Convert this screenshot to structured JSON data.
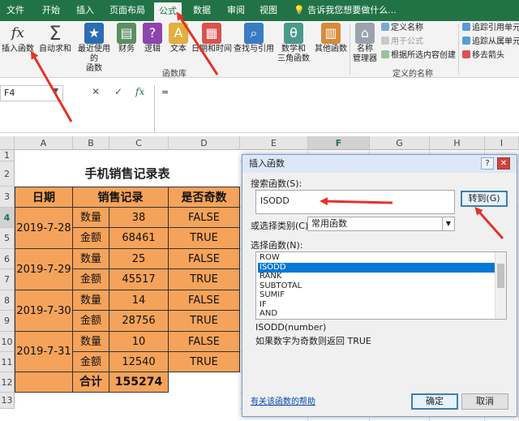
{
  "ribbon_tabs": [
    "文件",
    "开始",
    "插入",
    "页面布局",
    "公式",
    "数据",
    "审阅",
    "视图"
  ],
  "active_tab": "公式",
  "tell_me": "告诉我您想要做什么...",
  "ribbon_buttons": {
    "insert_function": "插入函数",
    "autosum": "自动求和",
    "recent_line1": "最近使用的",
    "recent_line2": "函数",
    "financial": "财务",
    "logical": "逻辑",
    "text": "文本",
    "datetime": "日期和时间",
    "lookup": "查找与引用",
    "math_line1": "数学和",
    "math_line2": "三角函数",
    "more": "其他函数",
    "name_mgr_line1": "名称",
    "name_mgr_line2": "管理器",
    "define_name": "定义名称",
    "use_in_formula": "用于公式",
    "create_from_sel": "根据所选内容创建",
    "trace_precedents": "追踪引用单元",
    "trace_dependents": "追踪从属单元",
    "remove_arrows": "移去箭头"
  },
  "group_labels": {
    "function_library": "函数库",
    "defined_names": "定义的名称"
  },
  "formula_bar": {
    "name_box": "F4",
    "cancel": "✕",
    "enter": "✓",
    "fx": "fx",
    "content": "="
  },
  "columns": [
    "A",
    "B",
    "C",
    "D",
    "E",
    "F",
    "G",
    "H",
    "I"
  ],
  "rows": [
    "1",
    "2",
    "3",
    "4",
    "5",
    "6",
    "7",
    "8",
    "9",
    "10",
    "11",
    "12",
    "13"
  ],
  "sheet": {
    "title": "手机销售记录表",
    "headers": {
      "date": "日期",
      "sales": "销售记录",
      "is_odd": "是否奇数"
    },
    "groups": [
      {
        "date": "2019-7-28",
        "qty_label": "数量",
        "qty": "38",
        "qty_odd": "FALSE",
        "amt_label": "金额",
        "amt": "68461",
        "amt_odd": "TRUE"
      },
      {
        "date": "2019-7-29",
        "qty_label": "数量",
        "qty": "25",
        "qty_odd": "FALSE",
        "amt_label": "金额",
        "amt": "45517",
        "amt_odd": "TRUE"
      },
      {
        "date": "2019-7-30",
        "qty_label": "数量",
        "qty": "14",
        "qty_odd": "FALSE",
        "amt_label": "金额",
        "amt": "28756",
        "amt_odd": "TRUE"
      },
      {
        "date": "2019-7-31",
        "qty_label": "数量",
        "qty": "10",
        "qty_odd": "FALSE",
        "amt_label": "金额",
        "amt": "12540",
        "amt_odd": "TRUE"
      }
    ],
    "total_label": "合计",
    "total_value": "155274"
  },
  "dialog": {
    "title": "插入函数",
    "help": "?",
    "close": "✕",
    "search_label": "搜索函数(S):",
    "search_value": "ISODD",
    "goto": "转到(G)",
    "category_label": "或选择类别(C):",
    "category_value": "常用函数",
    "select_label": "选择函数(N):",
    "functions": [
      "ROW",
      "ISODD",
      "RANK",
      "SUBTOTAL",
      "SUMIF",
      "IF",
      "AND"
    ],
    "selected_function": "ISODD",
    "signature": "ISODD(number)",
    "description": "如果数字为奇数则返回 TRUE",
    "help_link": "有关该函数的帮助",
    "ok": "确定",
    "cancel": "取消"
  },
  "colors": {
    "excel_green": "#217346",
    "cell_fill": "#f5a35a",
    "arrow": "#e53228",
    "selection": "#0078d7"
  }
}
